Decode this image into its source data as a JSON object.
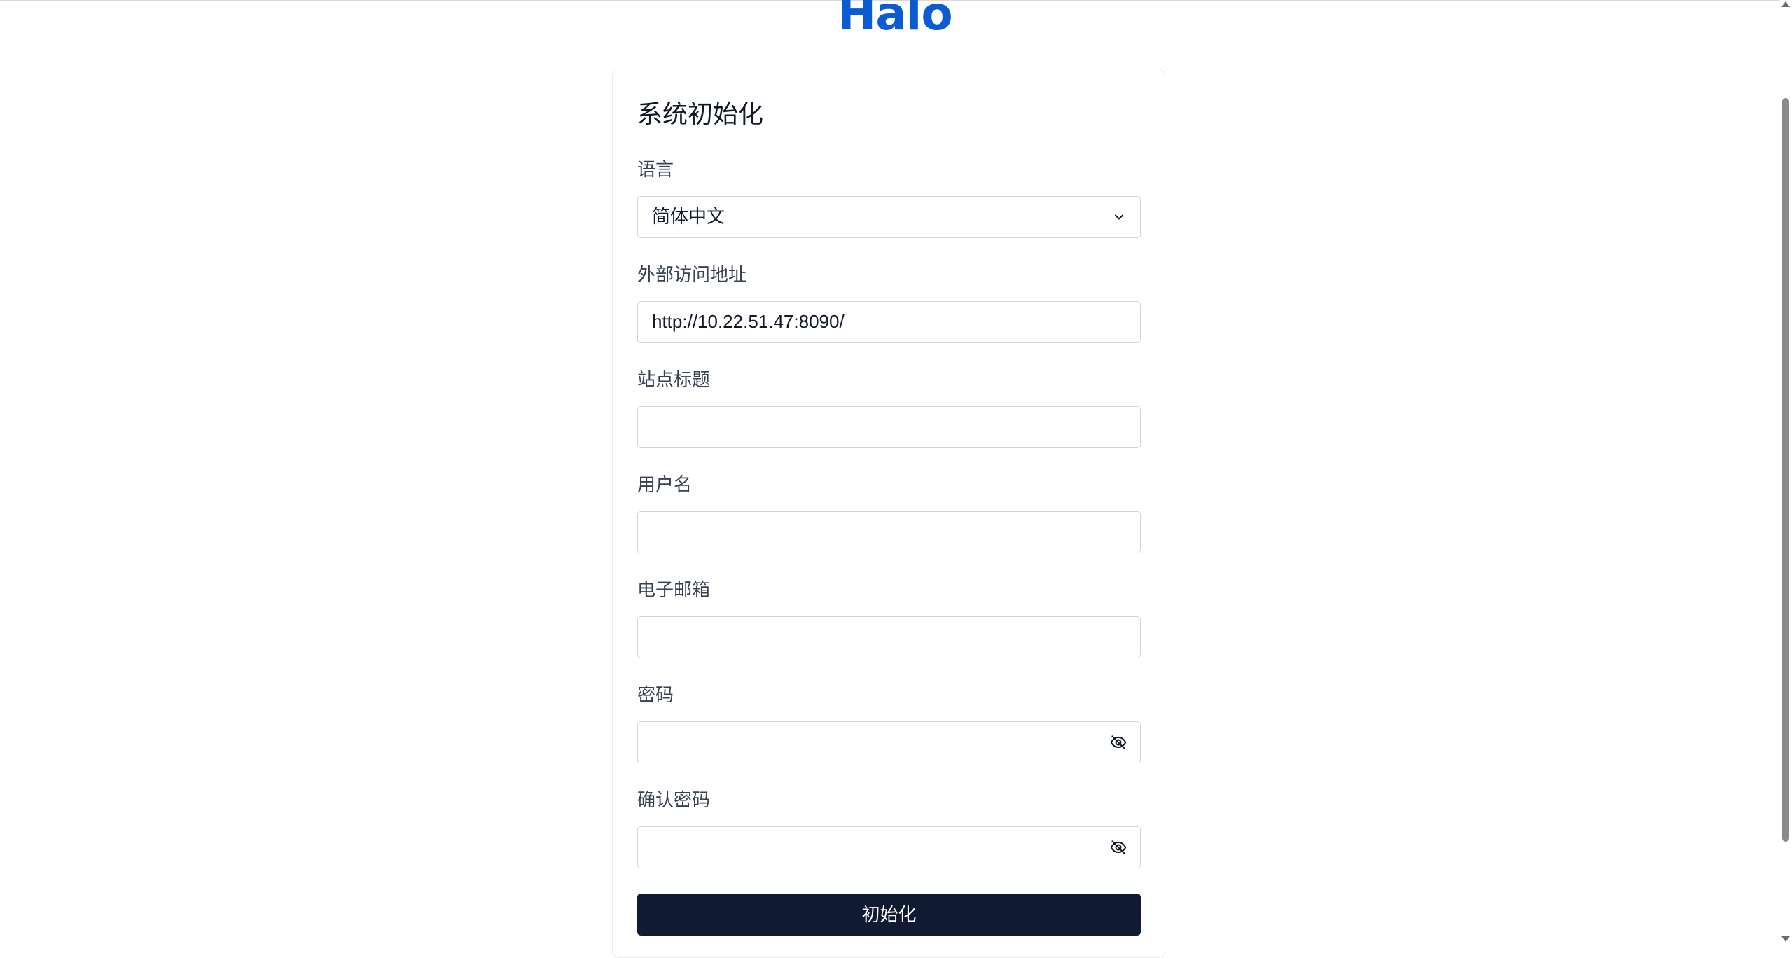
{
  "logo": {
    "text": "Halo",
    "color": "#0b5bd3"
  },
  "form": {
    "title": "系统初始化",
    "language": {
      "label": "语言",
      "value": "简体中文"
    },
    "external_url": {
      "label": "外部访问地址",
      "value": "http://10.22.51.47:8090/"
    },
    "site_title": {
      "label": "站点标题",
      "value": ""
    },
    "username": {
      "label": "用户名",
      "value": ""
    },
    "email": {
      "label": "电子邮箱",
      "value": ""
    },
    "password": {
      "label": "密码",
      "value": ""
    },
    "confirm_password": {
      "label": "确认密码",
      "value": ""
    },
    "submit_label": "初始化"
  },
  "colors": {
    "button_bg": "#111a33",
    "border": "#d1d5db"
  },
  "icons": {
    "select": "chevron-down-icon",
    "password_toggle": "eye-off-icon"
  }
}
